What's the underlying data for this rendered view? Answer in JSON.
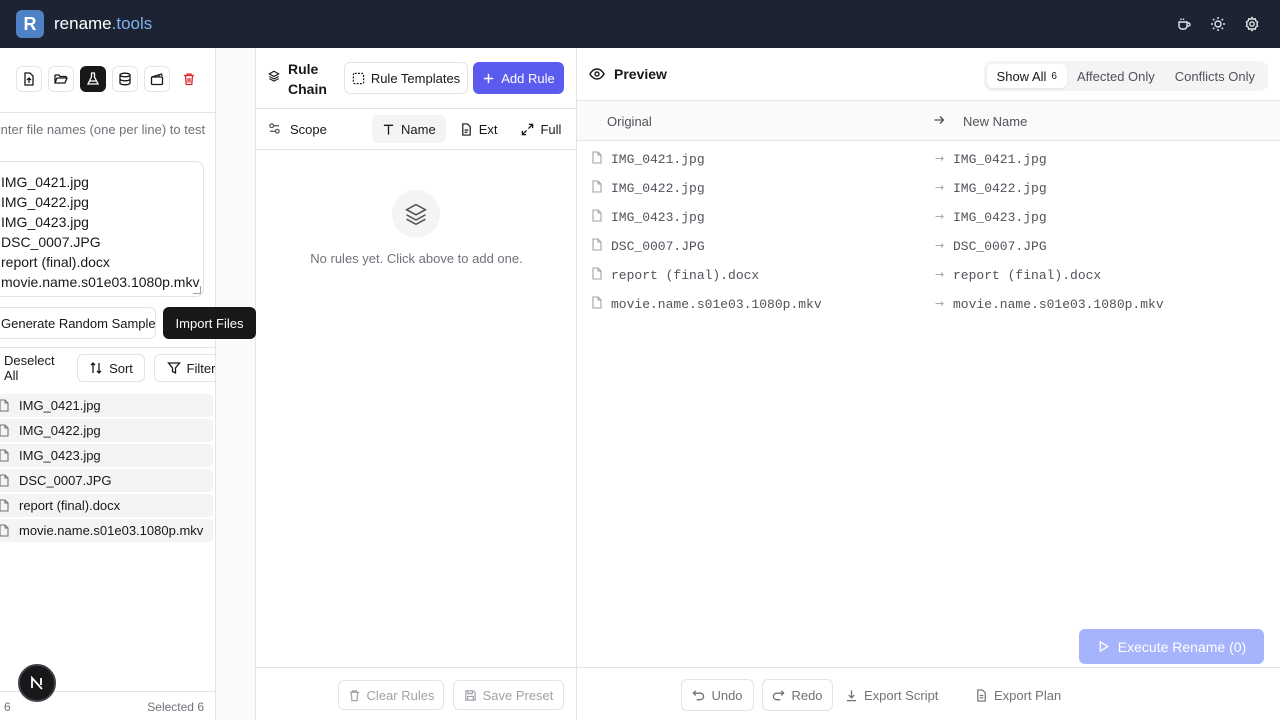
{
  "header": {
    "logo_letter": "R",
    "brand_name": "rename",
    "brand_tld": ".tools",
    "icons": [
      "coffee-icon",
      "sun-icon",
      "gear-icon"
    ]
  },
  "left": {
    "toolbar_icons": [
      "file-upload-icon",
      "folder-open-icon",
      "flask-icon",
      "database-icon",
      "clapperboard-icon",
      "trash-icon"
    ],
    "hint": "Enter file names (one per line) to test",
    "names_lines": [
      "IMG_0421.jpg",
      "IMG_0422.jpg",
      "IMG_0423.jpg",
      "DSC_0007.JPG",
      "report (final).docx",
      "movie.name.s01e03.1080p.mkv"
    ],
    "generate_label": "Generate Random Samples",
    "import_label": "Import Files",
    "deselect_label": "Deselect All",
    "sort_label": "Sort",
    "filter_label": "Filter",
    "files": [
      "IMG_0421.jpg",
      "IMG_0422.jpg",
      "IMG_0423.jpg",
      "DSC_0007.JPG",
      "report (final).docx",
      "movie.name.s01e03.1080p.mkv"
    ],
    "footer_count": "6",
    "footer_selected": "Selected 6",
    "badge_letter": "N"
  },
  "middle": {
    "title": "Rule Chain",
    "templates_label": "Rule Templates",
    "add_label": "Add Rule",
    "scope_label": "Scope",
    "scope_tabs": [
      {
        "label": "Name",
        "icon": "text-icon",
        "active": true
      },
      {
        "label": "Ext",
        "icon": "file-ext-icon",
        "active": false
      },
      {
        "label": "Full",
        "icon": "expand-icon",
        "active": false
      }
    ],
    "empty_text": "No rules yet. Click above to add one.",
    "clear_label": "Clear Rules",
    "save_label": "Save Preset"
  },
  "preview": {
    "title": "Preview",
    "filters": [
      {
        "label": "Show All",
        "count": "6",
        "active": true
      },
      {
        "label": "Affected Only",
        "count": "",
        "active": false
      },
      {
        "label": "Conflicts Only",
        "count": "",
        "active": false
      }
    ],
    "col_original": "Original",
    "col_new": "New Name",
    "rows": [
      {
        "original": "IMG_0421.jpg",
        "new": "IMG_0421.jpg"
      },
      {
        "original": "IMG_0422.jpg",
        "new": "IMG_0422.jpg"
      },
      {
        "original": "IMG_0423.jpg",
        "new": "IMG_0423.jpg"
      },
      {
        "original": "DSC_0007.JPG",
        "new": "DSC_0007.JPG"
      },
      {
        "original": "report (final).docx",
        "new": "report (final).docx"
      },
      {
        "original": "movie.name.s01e03.1080p.mkv",
        "new": "movie.name.s01e03.1080p.mkv"
      }
    ],
    "undo_label": "Undo",
    "redo_label": "Redo",
    "export_script_label": "Export Script",
    "export_plan_label": "Export Plan",
    "execute_label": "Execute Rename (0)"
  },
  "colors": {
    "topbar": "#1c2333",
    "accent": "#5b5bf0",
    "execute_disabled": "#a5b4fc",
    "danger": "#dc2626"
  }
}
